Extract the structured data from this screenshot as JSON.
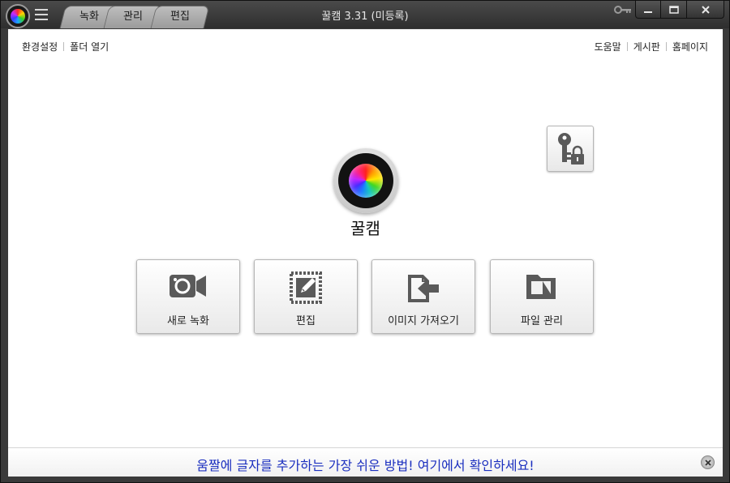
{
  "window": {
    "title": "꿀캠 3.31 (미등록)",
    "tabs": [
      {
        "label": "녹화"
      },
      {
        "label": "관리"
      },
      {
        "label": "편집"
      }
    ]
  },
  "toplinks": {
    "left": [
      "환경설정",
      "폴더 열기"
    ],
    "right": [
      "도움말",
      "게시판",
      "홈페이지"
    ]
  },
  "brand": {
    "name": "꿀캠"
  },
  "actions": [
    {
      "label": "새로 녹화",
      "icon": "video-camera-icon"
    },
    {
      "label": "편집",
      "icon": "edit-image-icon"
    },
    {
      "label": "이미지 가져오기",
      "icon": "import-image-icon"
    },
    {
      "label": "파일 관리",
      "icon": "folder-icon"
    }
  ],
  "banner": {
    "text": "움짤에 글자를 추가하는 가장 쉬운 방법! 여기에서 확인하세요!"
  },
  "colors": {
    "banner_text": "#1b2fbf",
    "titlebar": "#3a3a3a",
    "icon_gray": "#5a5a5a"
  }
}
